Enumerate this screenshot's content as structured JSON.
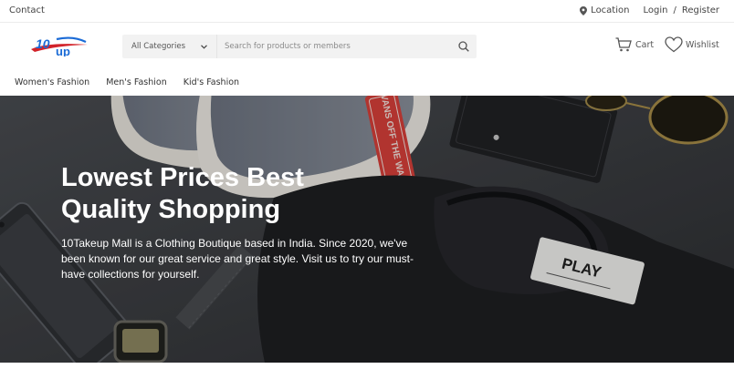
{
  "topbar": {
    "contact": "Contact",
    "location": "Location",
    "login": "Login",
    "separator": "/",
    "register": "Register"
  },
  "header": {
    "logo_text": "10up",
    "category_select": "All Categories",
    "search_placeholder": "Search for products or members",
    "cart_label": "Cart",
    "wishlist_label": "Wishlist"
  },
  "nav": {
    "items": [
      "Women's Fashion",
      "Men's Fashion",
      "Kid's Fashion"
    ]
  },
  "hero": {
    "title": "Lowest Prices Best Quality Shopping",
    "text": "10Takeup Mall is a Clothing Boutique based in India. Since 2020, we've been known for our great service and great style. Visit us to try our must-have collections for yourself.",
    "tag_text": "VANS OFF THE WALL",
    "label_text": "PLAY"
  },
  "colors": {
    "logo_blue": "#1b6bd6",
    "logo_red": "#d2232a",
    "hero_bg": "#3a3c40"
  }
}
